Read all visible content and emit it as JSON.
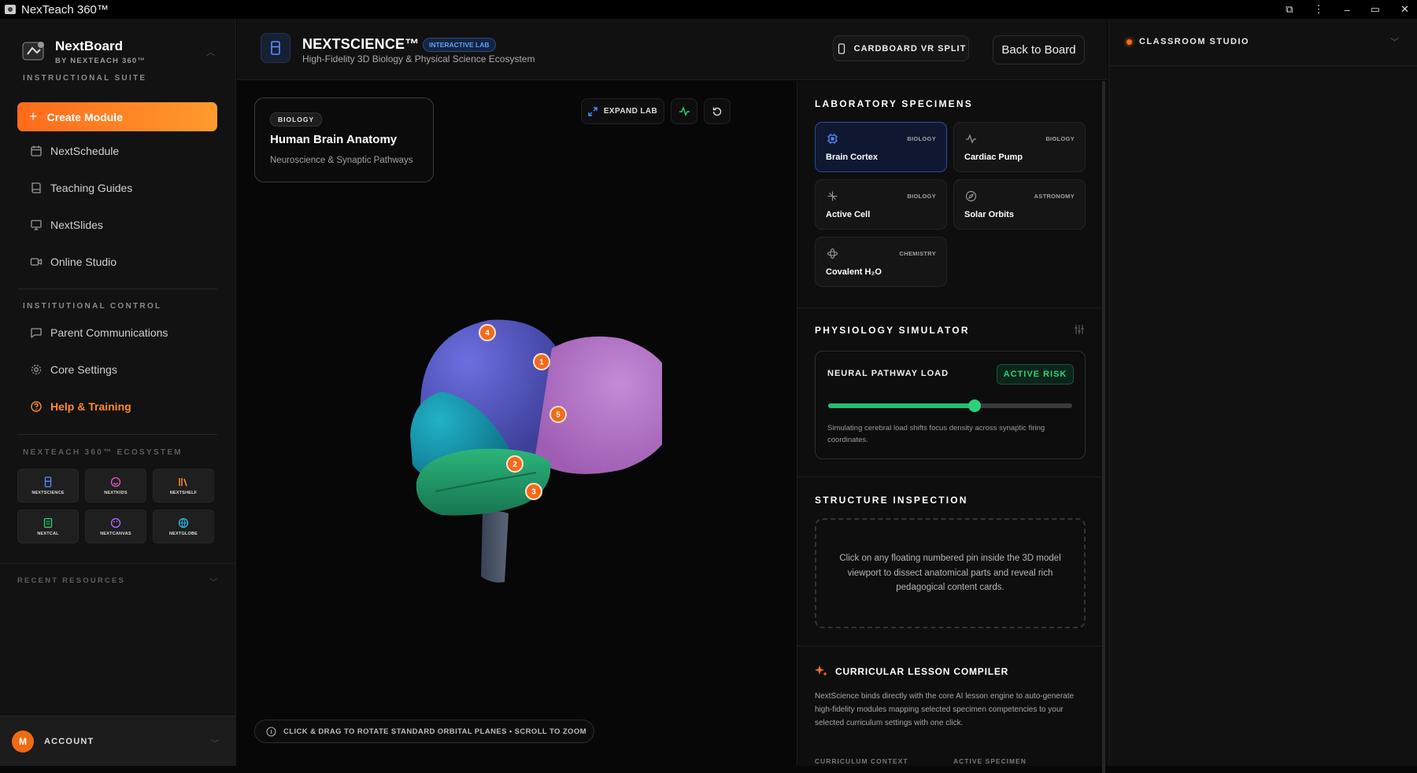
{
  "window": {
    "title": "NexTeach 360™",
    "controls": [
      "⧉",
      "⋮",
      "–",
      "▭",
      "✕"
    ]
  },
  "sidebar": {
    "brand_name": "NextBoard",
    "brand_sub": "BY NEXTEACH 360™",
    "section_instructional": "INSTRUCTIONAL SUITE",
    "create_label": "Create Module",
    "nav": [
      {
        "label": "NextSchedule",
        "icon": "calendar-icon"
      },
      {
        "label": "Teaching Guides",
        "icon": "book-icon"
      },
      {
        "label": "NextSlides",
        "icon": "presentation-icon"
      },
      {
        "label": "Online Studio",
        "icon": "video-icon"
      }
    ],
    "section_institutional": "INSTITUTIONAL CONTROL",
    "nav2": [
      {
        "label": "Parent Communications",
        "icon": "message-icon"
      },
      {
        "label": "Core Settings",
        "icon": "gear-icon"
      },
      {
        "label": "Help & Training",
        "icon": "help-icon"
      }
    ],
    "section_ecosystem": "NEXTEACH 360™ ECOSYSTEM",
    "ecosystem": [
      {
        "label": "NEXTSCIENCE",
        "icon": "beaker-icon",
        "color": "#5b8cff"
      },
      {
        "label": "NEXTKIDS",
        "icon": "smile-icon",
        "color": "#e855c8"
      },
      {
        "label": "NEXTSHELF",
        "icon": "library-icon",
        "color": "#ff9b2a"
      },
      {
        "label": "NEXTCAL",
        "icon": "calendar-icon",
        "color": "#2ad37a"
      },
      {
        "label": "NEXTCANVAS",
        "icon": "palette-icon",
        "color": "#b66bff"
      },
      {
        "label": "NEXTGLOBE",
        "icon": "globe-icon",
        "color": "#27b8e8"
      }
    ],
    "recent_label": "RECENT RESOURCES",
    "account_initial": "M",
    "account_label": "ACCOUNT"
  },
  "header": {
    "title": "NEXTSCIENCE™",
    "badge": "INTERACTIVE LAB",
    "subtitle": "High-Fidelity 3D Biology & Physical Science Ecosystem",
    "vr_button": "CARDBOARD VR SPLIT",
    "back_button": "Back to Board"
  },
  "viewport": {
    "tag": "BIOLOGY",
    "specimen_name": "Human Brain Anatomy",
    "specimen_sub": "Neuroscience & Synaptic Pathways",
    "expand_label": "EXPAND LAB",
    "pins": [
      "1",
      "2",
      "3",
      "4",
      "5"
    ],
    "hint": "CLICK & DRAG TO ROTATE STANDARD ORBITAL PLANES • SCROLL TO ZOOM"
  },
  "panel": {
    "specimens_title": "LABORATORY SPECIMENS",
    "specimens": [
      {
        "name": "Brain Cortex",
        "tag": "BIOLOGY",
        "icon": "chip-icon",
        "active": true
      },
      {
        "name": "Cardiac Pump",
        "tag": "BIOLOGY",
        "icon": "pulse-icon",
        "active": false
      },
      {
        "name": "Active Cell",
        "tag": "BIOLOGY",
        "icon": "sparkle-icon",
        "active": false
      },
      {
        "name": "Solar Orbits",
        "tag": "ASTRONOMY",
        "icon": "compass-icon",
        "active": false
      },
      {
        "name": "Covalent H₂O",
        "tag": "CHEMISTRY",
        "icon": "atom-icon",
        "active": false
      }
    ],
    "physio_title": "PHYSIOLOGY SIMULATOR",
    "physio_label": "NEURAL PATHWAY LOAD",
    "physio_badge": "ACTIVE RISK",
    "physio_level": 0.6,
    "physio_note": "Simulating cerebral load shifts focus density across synaptic firing coordinates.",
    "inspect_title": "STRUCTURE INSPECTION",
    "inspect_text": "Click on any floating numbered pin inside the 3D model viewport to dissect anatomical parts and reveal rich pedagogical content cards.",
    "compiler_title": "CURRICULAR LESSON COMPILER",
    "compiler_desc": "NextScience binds directly with the core AI lesson engine to auto-generate high-fidelity modules mapping selected specimen competencies to your selected curriculum settings with one click.",
    "compiler_ctx": "CURRICULUM CONTEXT",
    "compiler_spec": "ACTIVE SPECIMEN"
  },
  "studio": {
    "title": "CLASSROOM STUDIO"
  }
}
